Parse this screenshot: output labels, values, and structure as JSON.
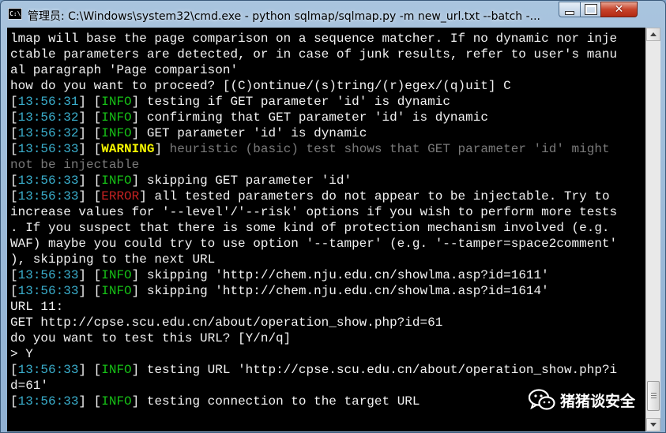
{
  "window": {
    "title": "管理员: C:\\Windows\\system32\\cmd.exe - python  sqlmap/sqlmap.py -m new_url.txt --batch -..."
  },
  "colors": {
    "timestamp": "#3aaecc",
    "info": "#16c016",
    "warning": "#f5f500",
    "error": "#c62222",
    "plain_text": "#f2f2f2",
    "dim_text": "#7a7a7a",
    "background": "#000000"
  },
  "console": {
    "lines": [
      {
        "text": "lmap will base the page comparison on a sequence matcher. If no dynamic nor inje"
      },
      {
        "text": "ctable parameters are detected, or in case of junk results, refer to user's manu"
      },
      {
        "text": "al paragraph 'Page comparison'"
      },
      {
        "text": "how do you want to proceed? [(C)ontinue/(s)tring/(r)egex/(q)uit] C"
      },
      {
        "ts": "13:56:31",
        "level": "INFO",
        "msg": " testing if GET parameter 'id' is dynamic"
      },
      {
        "ts": "13:56:32",
        "level": "INFO",
        "msg": " confirming that GET parameter 'id' is dynamic"
      },
      {
        "ts": "13:56:32",
        "level": "INFO",
        "msg": " GET parameter 'id' is dynamic"
      },
      {
        "ts": "13:56:33",
        "level": "WARNING",
        "msg": " heuristic (basic) test shows that GET parameter 'id' might"
      },
      {
        "text": "not be injectable",
        "dim": true
      },
      {
        "ts": "13:56:33",
        "level": "INFO",
        "msg": " skipping GET parameter 'id'"
      },
      {
        "ts": "13:56:33",
        "level": "ERROR",
        "msg": " all tested parameters do not appear to be injectable. Try to"
      },
      {
        "text": "increase values for '--level'/'--risk' options if you wish to perform more tests"
      },
      {
        "text": ". If you suspect that there is some kind of protection mechanism involved (e.g."
      },
      {
        "text": "WAF) maybe you could try to use option '--tamper' (e.g. '--tamper=space2comment'"
      },
      {
        "text": "), skipping to the next URL"
      },
      {
        "ts": "13:56:33",
        "level": "INFO",
        "msg": " skipping 'http://chem.nju.edu.cn/showlma.asp?id=1611'"
      },
      {
        "ts": "13:56:33",
        "level": "INFO",
        "msg": " skipping 'http://chem.nju.edu.cn/showlma.asp?id=1614'"
      },
      {
        "text": "URL 11:"
      },
      {
        "text": "GET http://cpse.scu.edu.cn/about/operation_show.php?id=61"
      },
      {
        "text": "do you want to test this URL? [Y/n/q]"
      },
      {
        "text": "> Y"
      },
      {
        "ts": "13:56:33",
        "level": "INFO",
        "msg": " testing URL 'http://cpse.scu.edu.cn/about/operation_show.php?i"
      },
      {
        "text": "d=61'"
      },
      {
        "ts": "13:56:33",
        "level": "INFO",
        "msg": " testing connection to the target URL"
      }
    ]
  },
  "watermark": {
    "text": "猪猪谈安全",
    "icon": "wechat-icon"
  }
}
